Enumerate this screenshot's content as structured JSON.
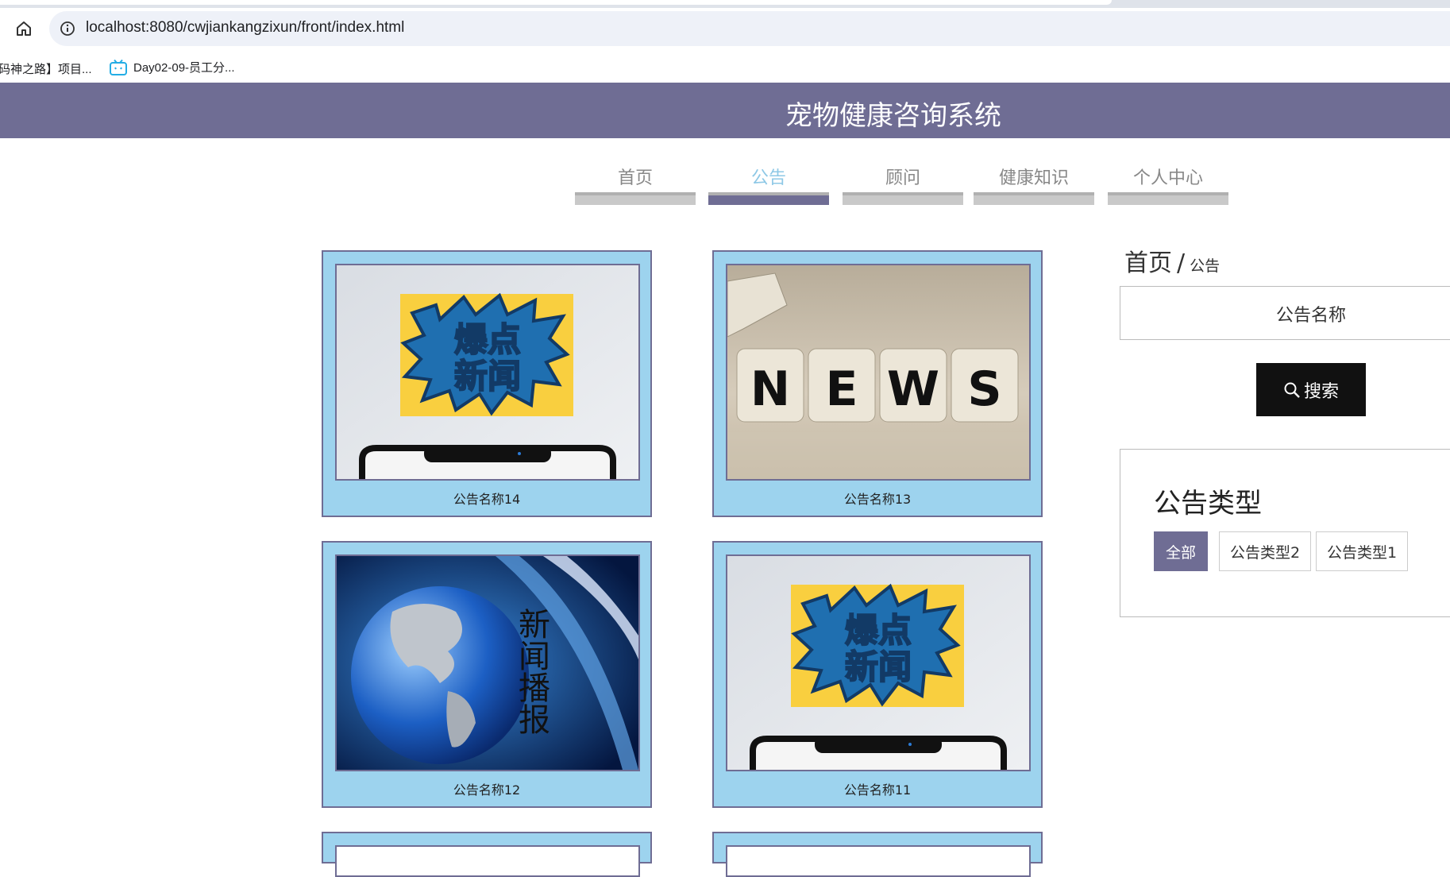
{
  "browser": {
    "url": "localhost:8080/cwjiankangzixun/front/index.html",
    "bookmarks": [
      {
        "label": "码神之路】项目..."
      },
      {
        "label": "Day02-09-员工分..."
      }
    ]
  },
  "site": {
    "title": "宠物健康咨询系统"
  },
  "nav": {
    "items": [
      {
        "label": "首页",
        "active": false
      },
      {
        "label": "公告",
        "active": true
      },
      {
        "label": "顾问",
        "active": false
      },
      {
        "label": "健康知识",
        "active": false
      },
      {
        "label": "个人中心",
        "active": false
      }
    ]
  },
  "cards": [
    {
      "caption": "公告名称14",
      "image": "burst-news"
    },
    {
      "caption": "公告名称13",
      "image": "news-cubes"
    },
    {
      "caption": "公告名称12",
      "image": "globe-broadcast"
    },
    {
      "caption": "公告名称11",
      "image": "burst-news"
    }
  ],
  "images": {
    "burst_text_top": "爆点",
    "burst_text_bottom": "新闻",
    "cube_letters": [
      "N",
      "E",
      "W",
      "S"
    ],
    "broadcast_text": "新闻播报"
  },
  "sidebar": {
    "breadcrumb_home": "首页",
    "breadcrumb_sep": "/",
    "breadcrumb_current": "公告",
    "search_placeholder": "公告名称",
    "search_button": "搜索",
    "type_title": "公告类型",
    "types": [
      {
        "label": "全部",
        "active": true
      },
      {
        "label": "公告类型2",
        "active": false
      },
      {
        "label": "公告类型1",
        "active": false
      }
    ]
  },
  "colors": {
    "header": "#6f6d94",
    "card_bg": "#9dd3ee",
    "nav_active": "#8ec8e6"
  }
}
